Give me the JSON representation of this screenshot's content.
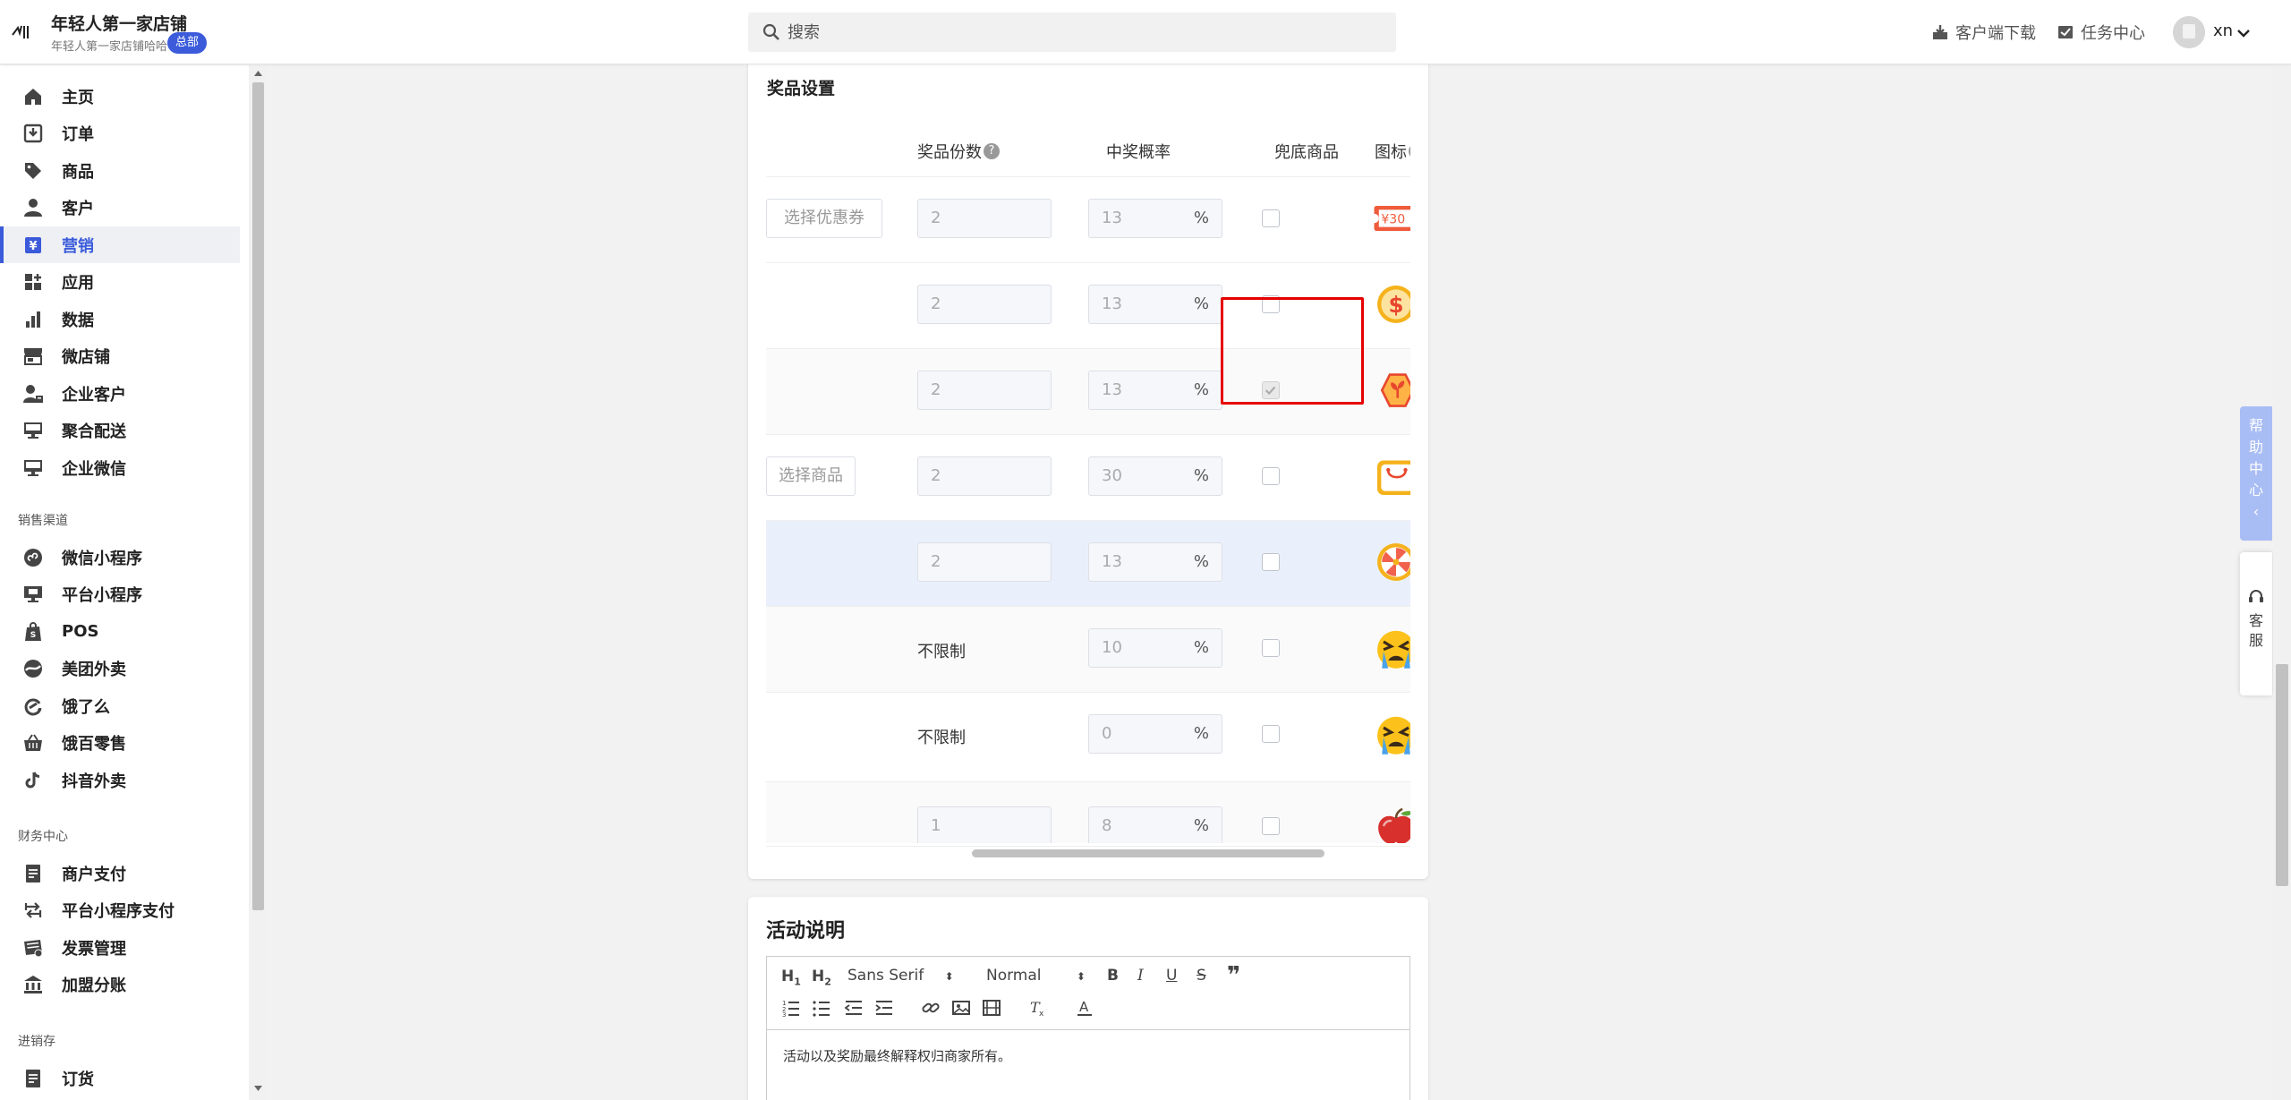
{
  "header": {
    "store_name": "年轻人第一家店铺",
    "store_sub": "年轻人第一家店铺哈哈",
    "badge": "总部",
    "search_placeholder": "搜索",
    "download_label": "客户端下载",
    "tasks_label": "任务中心",
    "username": "xn"
  },
  "sidebar": {
    "items": [
      {
        "label": "主页",
        "icon": "home-icon"
      },
      {
        "label": "订单",
        "icon": "order-icon"
      },
      {
        "label": "商品",
        "icon": "tag-icon"
      },
      {
        "label": "客户",
        "icon": "user-icon"
      },
      {
        "label": "营销",
        "icon": "yuan-icon",
        "active": true
      },
      {
        "label": "应用",
        "icon": "apps-icon"
      },
      {
        "label": "数据",
        "icon": "bar-chart-icon"
      },
      {
        "label": "微店铺",
        "icon": "store-icon"
      },
      {
        "label": "企业客户",
        "icon": "enterprise-user-icon"
      },
      {
        "label": "聚合配送",
        "icon": "monitor-icon"
      },
      {
        "label": "企业微信",
        "icon": "monitor-icon"
      }
    ],
    "section_sales": "销售渠道",
    "sales_items": [
      {
        "label": "微信小程序",
        "icon": "miniprogram-icon"
      },
      {
        "label": "平台小程序",
        "icon": "platform-icon"
      },
      {
        "label": "POS",
        "icon": "shopify-bag-icon"
      },
      {
        "label": "美团外卖",
        "icon": "meituan-icon"
      },
      {
        "label": "饿了么",
        "icon": "eleme-icon"
      },
      {
        "label": "饿百零售",
        "icon": "basket-icon"
      },
      {
        "label": "抖音外卖",
        "icon": "tiktok-icon"
      }
    ],
    "section_finance": "财务中心",
    "finance_items": [
      {
        "label": "商户支付",
        "icon": "document-icon"
      },
      {
        "label": "平台小程序支付",
        "icon": "exchange-icon"
      },
      {
        "label": "发票管理",
        "icon": "invoice-icon"
      },
      {
        "label": "加盟分账",
        "icon": "bank-icon"
      }
    ],
    "section_inventory": "进销存",
    "inventory_items": [
      {
        "label": "订货",
        "icon": "document-icon"
      }
    ]
  },
  "prize_table": {
    "title": "奖品设置",
    "columns": {
      "quantity": "奖品份数",
      "rate": "中奖概率",
      "fallback": "兜底商品",
      "icon": "图标"
    },
    "select_coupon": "选择优惠券",
    "select_product": "选择商品",
    "percent": "%",
    "rows": [
      {
        "selector": "coupon",
        "quantity": "2",
        "rate": "13",
        "fallback": false,
        "icon": "coupon-icon"
      },
      {
        "selector": "",
        "quantity": "2",
        "rate": "13",
        "fallback": false,
        "icon": "dollar-coin-icon"
      },
      {
        "selector": "",
        "quantity": "2",
        "rate": "13",
        "fallback": true,
        "icon": "sprout-icon"
      },
      {
        "selector": "product",
        "quantity": "2",
        "rate": "30",
        "fallback": false,
        "icon": "shopping-bag-icon"
      },
      {
        "selector": "",
        "quantity": "2",
        "rate": "13",
        "fallback": false,
        "icon": "wheel-icon",
        "highlighted": true
      },
      {
        "selector": "",
        "quantity_text": "不限制",
        "rate": "10",
        "fallback": false,
        "icon": "crying-face-icon"
      },
      {
        "selector": "",
        "quantity_text": "不限制",
        "rate": "0",
        "fallback": false,
        "icon": "crying-face-icon"
      },
      {
        "selector": "",
        "quantity": "1",
        "rate": "8",
        "fallback": false,
        "icon": "apple-icon"
      }
    ],
    "coupon_label": "¥30"
  },
  "description": {
    "title": "活动说明",
    "font_family": "Sans Serif",
    "font_size": "Normal",
    "content": "活动以及奖励最终解释权归商家所有。"
  },
  "widgets": {
    "help": [
      "帮",
      "助",
      "中",
      "心"
    ],
    "service": [
      "客",
      "服"
    ]
  },
  "colors": {
    "accent": "#3b5bdb",
    "highlight_row": "#eaf0fb",
    "annotation_red": "#e60000"
  }
}
